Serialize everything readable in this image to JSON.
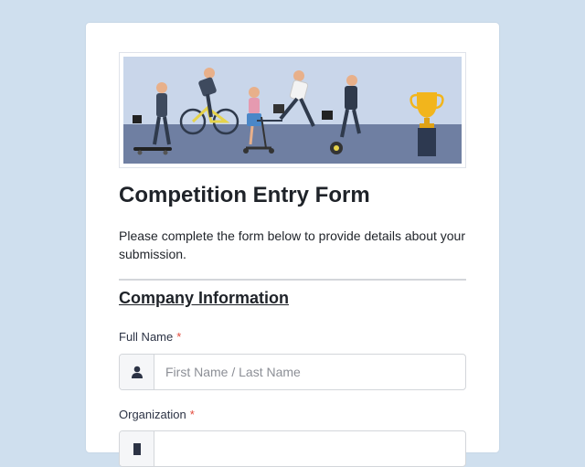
{
  "form": {
    "title": "Competition Entry Form",
    "description": "Please complete the form below to provide details about your submission.",
    "section_title": "Company Information",
    "fields": [
      {
        "label": "Full Name",
        "required_marker": "*",
        "placeholder": "First Name / Last Name",
        "value": "",
        "icon": "user-icon"
      },
      {
        "label": "Organization",
        "required_marker": "*",
        "placeholder": "",
        "value": "",
        "icon": "building-icon"
      }
    ]
  },
  "banner": {
    "image": "illustration of business people racing (skateboard, bicycle, scooter, running, hoverboard) toward a gold trophy",
    "colors": {
      "ground": "#6f7fa2",
      "sky": "#c9d6ea",
      "trophy": "#f2b51c"
    }
  },
  "colors": {
    "background": "#cfdfee",
    "card": "#ffffff",
    "required": "#e3493b",
    "text": "#1f2329"
  }
}
